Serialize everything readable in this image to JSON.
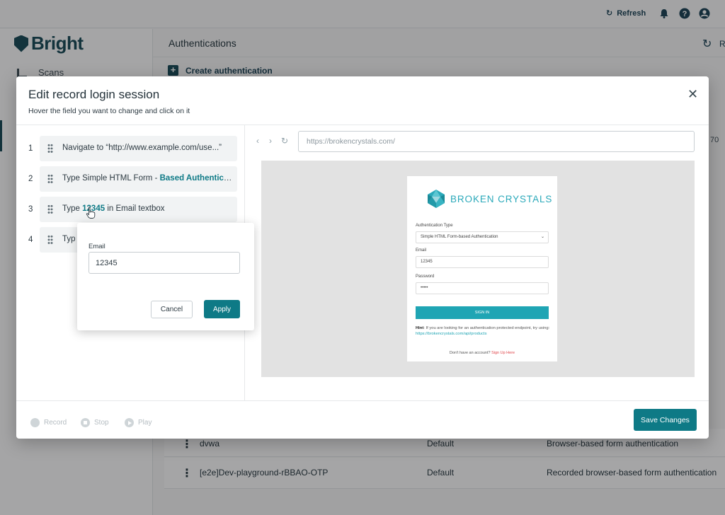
{
  "topbar": {
    "refresh_label": "Refresh"
  },
  "sidebar": {
    "brand": "Bright",
    "items": [
      {
        "label": "Scans"
      }
    ]
  },
  "main": {
    "title": "Authentications",
    "create_label": "Create authentication",
    "refresh_peek": "R",
    "peek_text": "70",
    "rows": [
      {
        "name": "dvwa",
        "scope": "Default",
        "type": "Browser-based form authentication"
      },
      {
        "name": "[e2e]Dev-playground-rBBAO-OTP",
        "scope": "Default",
        "type": "Recorded browser-based form authentication"
      }
    ]
  },
  "modal": {
    "title": "Edit record login session",
    "subtitle": "Hover the field you want to change and click on it",
    "close_glyph": "✕",
    "steps": [
      {
        "num": "1",
        "prefix": "Navigate to “http://www.example.com/use...”",
        "highlight": "",
        "suffix": ""
      },
      {
        "num": "2",
        "prefix": "Type Simple HTML Form - ",
        "highlight": "Based Authentica...",
        "suffix": ""
      },
      {
        "num": "3",
        "prefix": "Type ",
        "highlight": "12345",
        "suffix": " in Email textbox"
      },
      {
        "num": "4",
        "prefix": "Typ",
        "highlight": "",
        "suffix": ""
      }
    ],
    "popover": {
      "label": "Email",
      "value": "12345",
      "cancel": "Cancel",
      "apply": "Apply"
    },
    "browser": {
      "url_placeholder": "https://brokencrystals.com/",
      "back_glyph": "‹",
      "forward_glyph": "›",
      "reload_glyph": "↻"
    },
    "preview": {
      "brand": "BROKEN CRYSTALS",
      "auth_type_label": "Authentication Type",
      "auth_type_value": "Simple HTML Form-based Authentication",
      "email_label": "Email",
      "email_value": "12345",
      "password_label": "Password",
      "password_value": "•••••",
      "signin": "SIGN IN",
      "hint_bold": "Hint",
      "hint_text": ": If you are looking for an authentication protected endpoint, try using:",
      "hint_link": "https://brokencrystals.com/api/products",
      "no_account": "Don't have an account?",
      "signup": "Sign Up Here"
    },
    "footer": {
      "record": "Record",
      "stop": "Stop",
      "play": "Play",
      "save": "Save Changes"
    }
  },
  "colors": {
    "accent": "#0e7a86",
    "brand": "#1d4e5c",
    "preview_accent": "#1fa5b4"
  }
}
